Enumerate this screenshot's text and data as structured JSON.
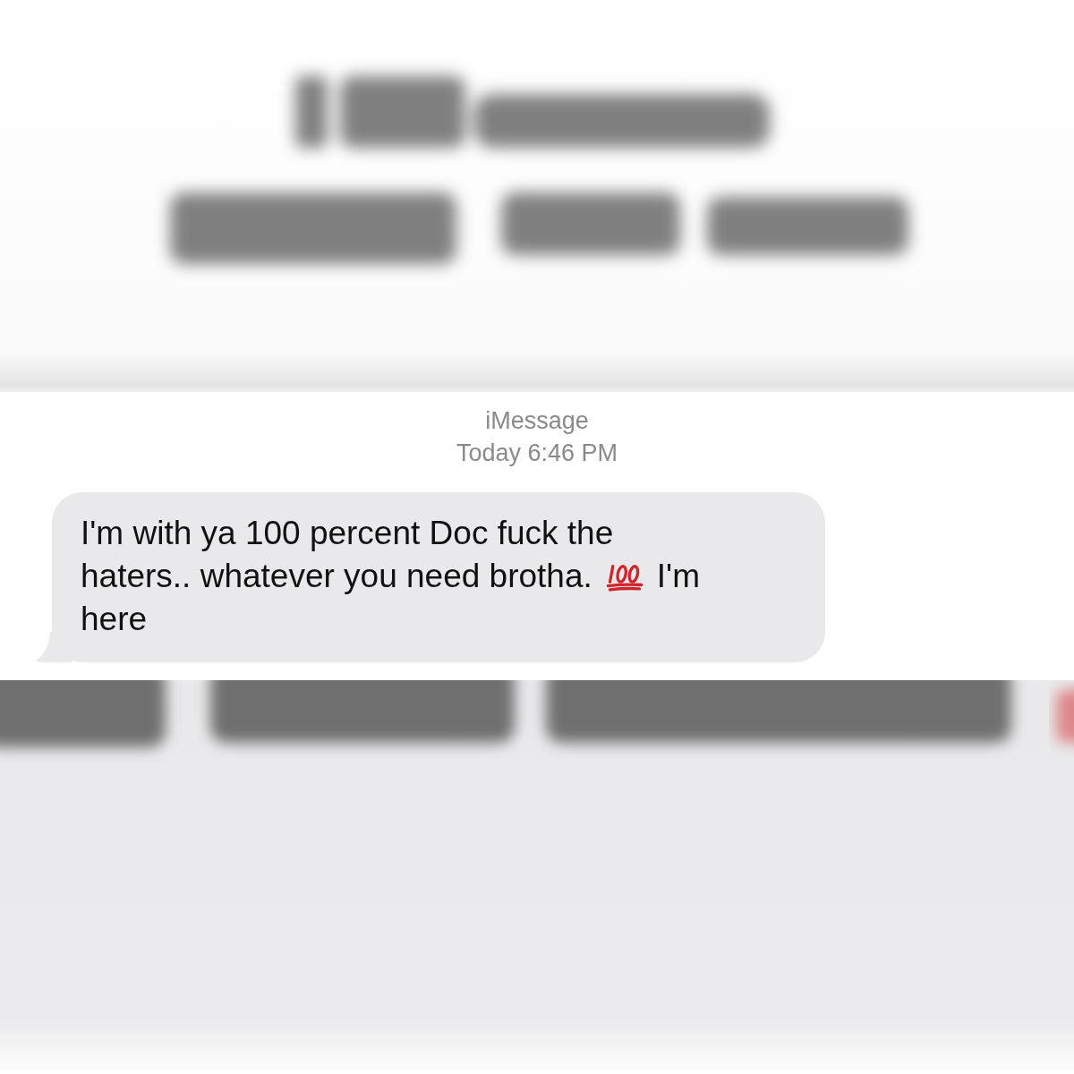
{
  "conversation": {
    "service": "iMessage",
    "timestamp": "Today 6:46 PM",
    "messages": [
      {
        "lines": [
          [
            {
              "kind": "text",
              "text": "I'm with ya 100 percent Doc fuck the"
            }
          ],
          [
            {
              "kind": "text",
              "text": "haters.. whatever you need brotha."
            },
            {
              "kind": "hundred_points"
            },
            {
              "kind": "text",
              "text": "I'm"
            }
          ],
          [
            {
              "kind": "text",
              "text": "here"
            }
          ]
        ]
      }
    ]
  }
}
